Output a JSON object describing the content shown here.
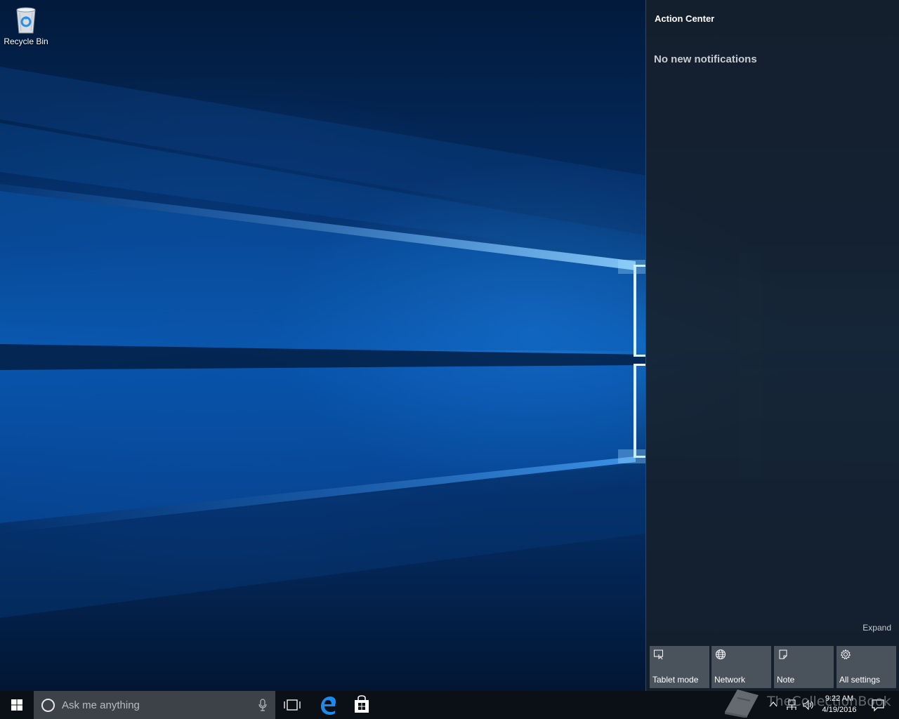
{
  "desktop": {
    "recycle_bin_label": "Recycle Bin"
  },
  "action_center": {
    "title": "Action Center",
    "empty_message": "No new notifications",
    "expand_label": "Expand",
    "quick_actions": [
      {
        "label": "Tablet mode",
        "icon": "tablet-mode-icon"
      },
      {
        "label": "Network",
        "icon": "network-globe-icon"
      },
      {
        "label": "Note",
        "icon": "note-icon"
      },
      {
        "label": "All settings",
        "icon": "gear-icon"
      }
    ]
  },
  "taskbar": {
    "search_placeholder": "Ask me anything",
    "pinned_apps": [
      "task-view-icon",
      "edge-icon",
      "store-icon"
    ],
    "clock_time": "9:22 AM",
    "clock_date": "4/19/2016"
  },
  "watermark": {
    "text": "TheCollectionBook"
  },
  "colors": {
    "accent": "#0078d7",
    "action_center_bg": "#16202c",
    "tile_bg": "#4a525c",
    "taskbar_bg": "#0b1017"
  }
}
